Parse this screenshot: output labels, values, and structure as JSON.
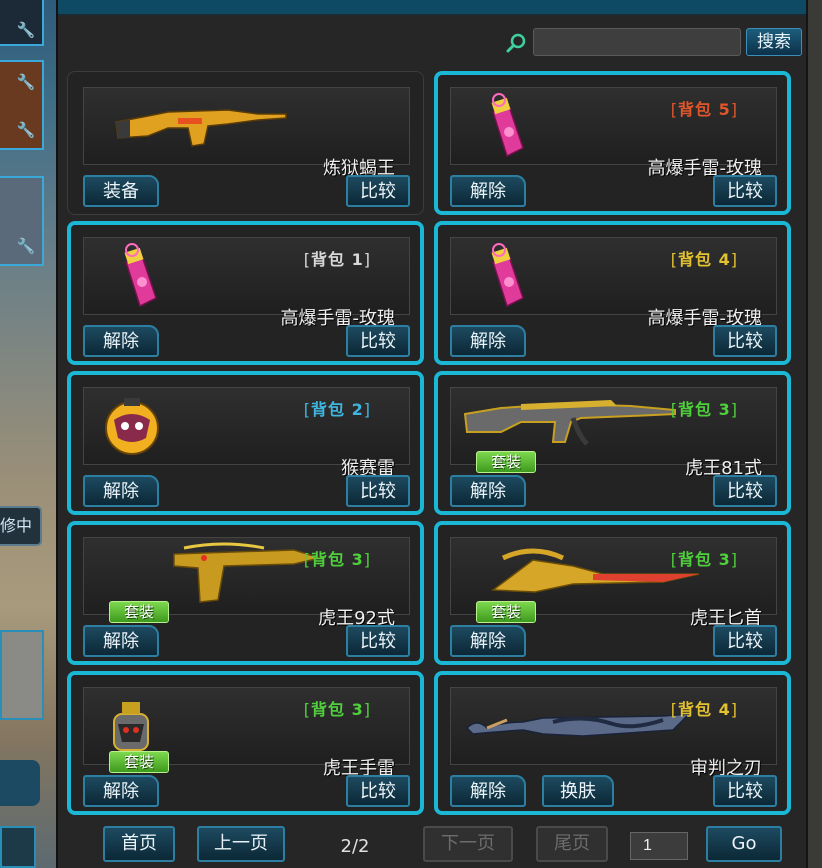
{
  "left_sidebar": {
    "status_label": "修中"
  },
  "search": {
    "placeholder": "",
    "button_label": "搜索"
  },
  "items": [
    {
      "name": "炼狱蝎王",
      "badge_text": "",
      "badge_color": "",
      "suit_label": "",
      "action_label": "装备",
      "compare_label": "比较",
      "selected": false,
      "icon": "yellow-assault-rifle"
    },
    {
      "name": "高爆手雷-玫瑰",
      "badge_text": "背包 5",
      "badge_color": "#e0562a",
      "suit_label": "",
      "action_label": "解除",
      "compare_label": "比较",
      "selected": true,
      "icon": "pink-grenade"
    },
    {
      "name": "高爆手雷-玫瑰",
      "badge_text": "背包 1",
      "badge_color": "#d8d8d8",
      "suit_label": "",
      "action_label": "解除",
      "compare_label": "比较",
      "selected": true,
      "icon": "pink-grenade"
    },
    {
      "name": "高爆手雷-玫瑰",
      "badge_text": "背包 4",
      "badge_color": "#e2c230",
      "suit_label": "",
      "action_label": "解除",
      "compare_label": "比较",
      "selected": true,
      "icon": "pink-grenade"
    },
    {
      "name": "猴赛雷",
      "badge_text": "背包 2",
      "badge_color": "#3fb6e0",
      "suit_label": "",
      "action_label": "解除",
      "compare_label": "比较",
      "selected": true,
      "icon": "monkey-bomb"
    },
    {
      "name": "虎王81式",
      "badge_text": "背包 3",
      "badge_color": "#4fcf3c",
      "suit_label": "套装",
      "action_label": "解除",
      "compare_label": "比较",
      "selected": true,
      "icon": "gold-rifle"
    },
    {
      "name": "虎王92式",
      "badge_text": "背包 3",
      "badge_color": "#4fcf3c",
      "suit_label": "套装",
      "action_label": "解除",
      "compare_label": "比较",
      "selected": true,
      "icon": "gold-pistol"
    },
    {
      "name": "虎王匕首",
      "badge_text": "背包 3",
      "badge_color": "#4fcf3c",
      "suit_label": "套装",
      "action_label": "解除",
      "compare_label": "比较",
      "selected": true,
      "icon": "gold-dagger"
    },
    {
      "name": "虎王手雷",
      "badge_text": "背包 3",
      "badge_color": "#4fcf3c",
      "suit_label": "套装",
      "action_label": "解除",
      "compare_label": "比较",
      "selected": true,
      "icon": "tiger-grenade"
    },
    {
      "name": "审判之刃",
      "badge_text": "背包 4",
      "badge_color": "#e2c230",
      "suit_label": "",
      "action_label": "解除",
      "compare_label": "比较",
      "skin_label": "换肤",
      "selected": true,
      "icon": "dark-blade"
    }
  ],
  "pagination": {
    "first_label": "首页",
    "prev_label": "上一页",
    "page_indicator": "2/2",
    "next_label": "下一页",
    "last_label": "尾页",
    "page_input_value": "1",
    "go_label": "Go"
  },
  "colors": {
    "selection_border": "#1bb8d6",
    "button_border": "#2d7fa2",
    "suit_green": "#5cc23a"
  }
}
